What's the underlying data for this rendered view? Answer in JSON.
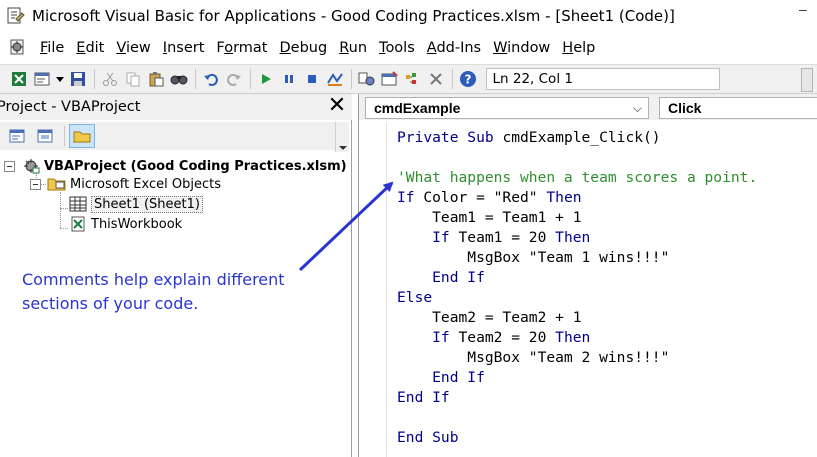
{
  "window": {
    "title": "Microsoft Visual Basic for Applications - Good Coding Practices.xlsm - [Sheet1 (Code)]",
    "minimize_glyph": "–"
  },
  "menu": {
    "items": [
      {
        "label": "File",
        "accel_index": 0
      },
      {
        "label": "Edit",
        "accel_index": 0
      },
      {
        "label": "View",
        "accel_index": 0
      },
      {
        "label": "Insert",
        "accel_index": 0
      },
      {
        "label": "Format",
        "accel_index": 1
      },
      {
        "label": "Debug",
        "accel_index": 0
      },
      {
        "label": "Run",
        "accel_index": 0
      },
      {
        "label": "Tools",
        "accel_index": 0
      },
      {
        "label": "Add-Ins",
        "accel_index": 0
      },
      {
        "label": "Window",
        "accel_index": 0
      },
      {
        "label": "Help",
        "accel_index": 0
      }
    ]
  },
  "toolbar": {
    "icons": [
      "excel-view-icon",
      "insert-module-icon",
      "dropdown-arrow-icon",
      "save-icon",
      "cut-icon",
      "copy-icon",
      "paste-icon",
      "find-icon",
      "undo-icon",
      "redo-icon",
      "run-icon",
      "break-icon",
      "reset-icon",
      "design-mode-icon",
      "project-explorer-icon",
      "properties-icon",
      "object-browser-icon",
      "toolbox-icon",
      "help-icon"
    ],
    "status": "Ln 22, Col 1"
  },
  "project": {
    "title": "Project - VBAProject",
    "close_glyph": "✕",
    "tree": {
      "root": "VBAProject (Good Coding Practices.xlsm)",
      "folder": "Microsoft Excel Objects",
      "items": [
        "Sheet1 (Sheet1)",
        "ThisWorkbook"
      ]
    }
  },
  "annotation": {
    "text": "Comments help explain different sections of your code.",
    "color": "#2a35d0"
  },
  "code": {
    "object": "cmdExample",
    "procedure": "Click",
    "combo_arrow": "⌵",
    "lines": [
      [
        {
          "t": "Private Sub ",
          "c": "kw"
        },
        {
          "t": "cmdExample_Click()",
          "c": ""
        }
      ],
      [
        {
          "t": "",
          "c": ""
        }
      ],
      [
        {
          "t": "'What happens when a team scores a point.",
          "c": "cm"
        }
      ],
      [
        {
          "t": "If ",
          "c": "kw"
        },
        {
          "t": "Color = \"Red\" ",
          "c": ""
        },
        {
          "t": "Then",
          "c": "kw"
        }
      ],
      [
        {
          "t": "    Team1 = Team1 + 1",
          "c": ""
        }
      ],
      [
        {
          "t": "    If ",
          "c": "kw"
        },
        {
          "t": "Team1 = 20 ",
          "c": ""
        },
        {
          "t": "Then",
          "c": "kw"
        }
      ],
      [
        {
          "t": "        MsgBox \"Team 1 wins!!!\"",
          "c": ""
        }
      ],
      [
        {
          "t": "    End If",
          "c": "kw"
        }
      ],
      [
        {
          "t": "Else",
          "c": "kw"
        }
      ],
      [
        {
          "t": "    Team2 = Team2 + 1",
          "c": ""
        }
      ],
      [
        {
          "t": "    If ",
          "c": "kw"
        },
        {
          "t": "Team2 = 20 ",
          "c": ""
        },
        {
          "t": "Then",
          "c": "kw"
        }
      ],
      [
        {
          "t": "        MsgBox \"Team 2 wins!!!\"",
          "c": ""
        }
      ],
      [
        {
          "t": "    End If",
          "c": "kw"
        }
      ],
      [
        {
          "t": "End If",
          "c": "kw"
        }
      ],
      [
        {
          "t": "",
          "c": ""
        }
      ],
      [
        {
          "t": "End Sub",
          "c": "kw"
        }
      ]
    ],
    "colors": {
      "keyword": "#00008b",
      "comment": "#2f8f2f"
    }
  }
}
